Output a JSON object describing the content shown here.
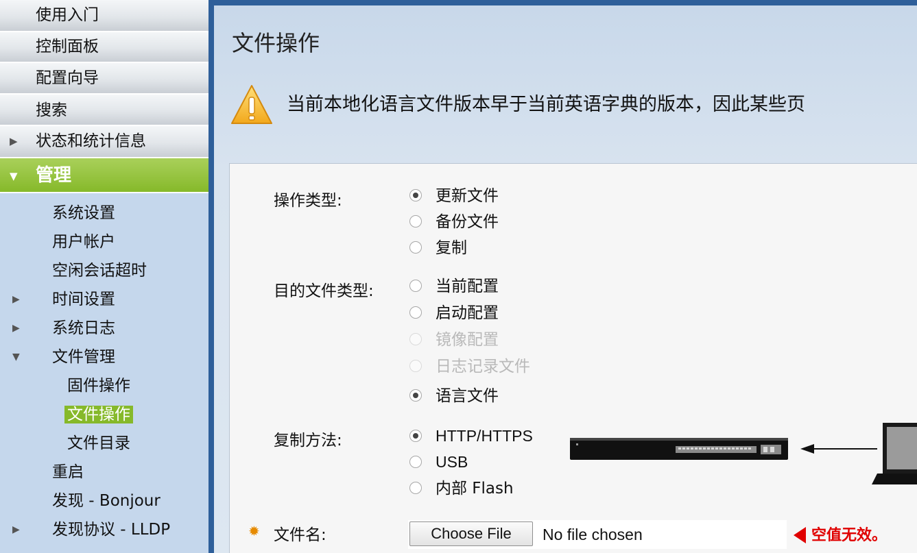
{
  "sidebar": {
    "top_items": [
      {
        "label": "使用入门"
      },
      {
        "label": "控制面板"
      },
      {
        "label": "配置向导"
      },
      {
        "label": "搜索"
      },
      {
        "label": "状态和统计信息"
      }
    ],
    "active_section": "管理",
    "sub_items": [
      {
        "label": "系统设置"
      },
      {
        "label": "用户帐户"
      },
      {
        "label": "空闲会话超时"
      },
      {
        "label": "时间设置"
      },
      {
        "label": "系统日志"
      },
      {
        "label": "文件管理"
      },
      {
        "label": "固件操作"
      },
      {
        "label": "文件操作"
      },
      {
        "label": "文件目录"
      },
      {
        "label": "重启"
      },
      {
        "label": "发现 - Bonjour"
      },
      {
        "label": "发现协议 - LLDP"
      }
    ]
  },
  "main": {
    "title": "文件操作",
    "warning_text": "当前本地化语言文件版本早于当前英语字典的版本，因此某些页",
    "operation_type": {
      "label": "操作类型:",
      "options": [
        {
          "label": "更新文件",
          "checked": true
        },
        {
          "label": "备份文件",
          "checked": false
        },
        {
          "label": "复制",
          "checked": false
        }
      ]
    },
    "dest_file_type": {
      "label": "目的文件类型:",
      "options": [
        {
          "label": "当前配置",
          "checked": false,
          "disabled": false
        },
        {
          "label": "启动配置",
          "checked": false,
          "disabled": false
        },
        {
          "label": "镜像配置",
          "checked": false,
          "disabled": true
        },
        {
          "label": "日志记录文件",
          "checked": false,
          "disabled": true
        },
        {
          "label": "语言文件",
          "checked": true,
          "disabled": false
        }
      ]
    },
    "copy_method": {
      "label": "复制方法:",
      "options": [
        {
          "label": "HTTP/HTTPS",
          "checked": true
        },
        {
          "label": "USB",
          "checked": false
        },
        {
          "label": "内部 Flash",
          "checked": false
        }
      ]
    },
    "file_name": {
      "label": "文件名:",
      "button_label": "Choose File",
      "status": "No file chosen",
      "error": "空值无效。"
    }
  },
  "colors": {
    "active_nav": "#86b92a",
    "error": "#e00000",
    "frame": "#2e5f9a",
    "required": "#e68a00"
  }
}
